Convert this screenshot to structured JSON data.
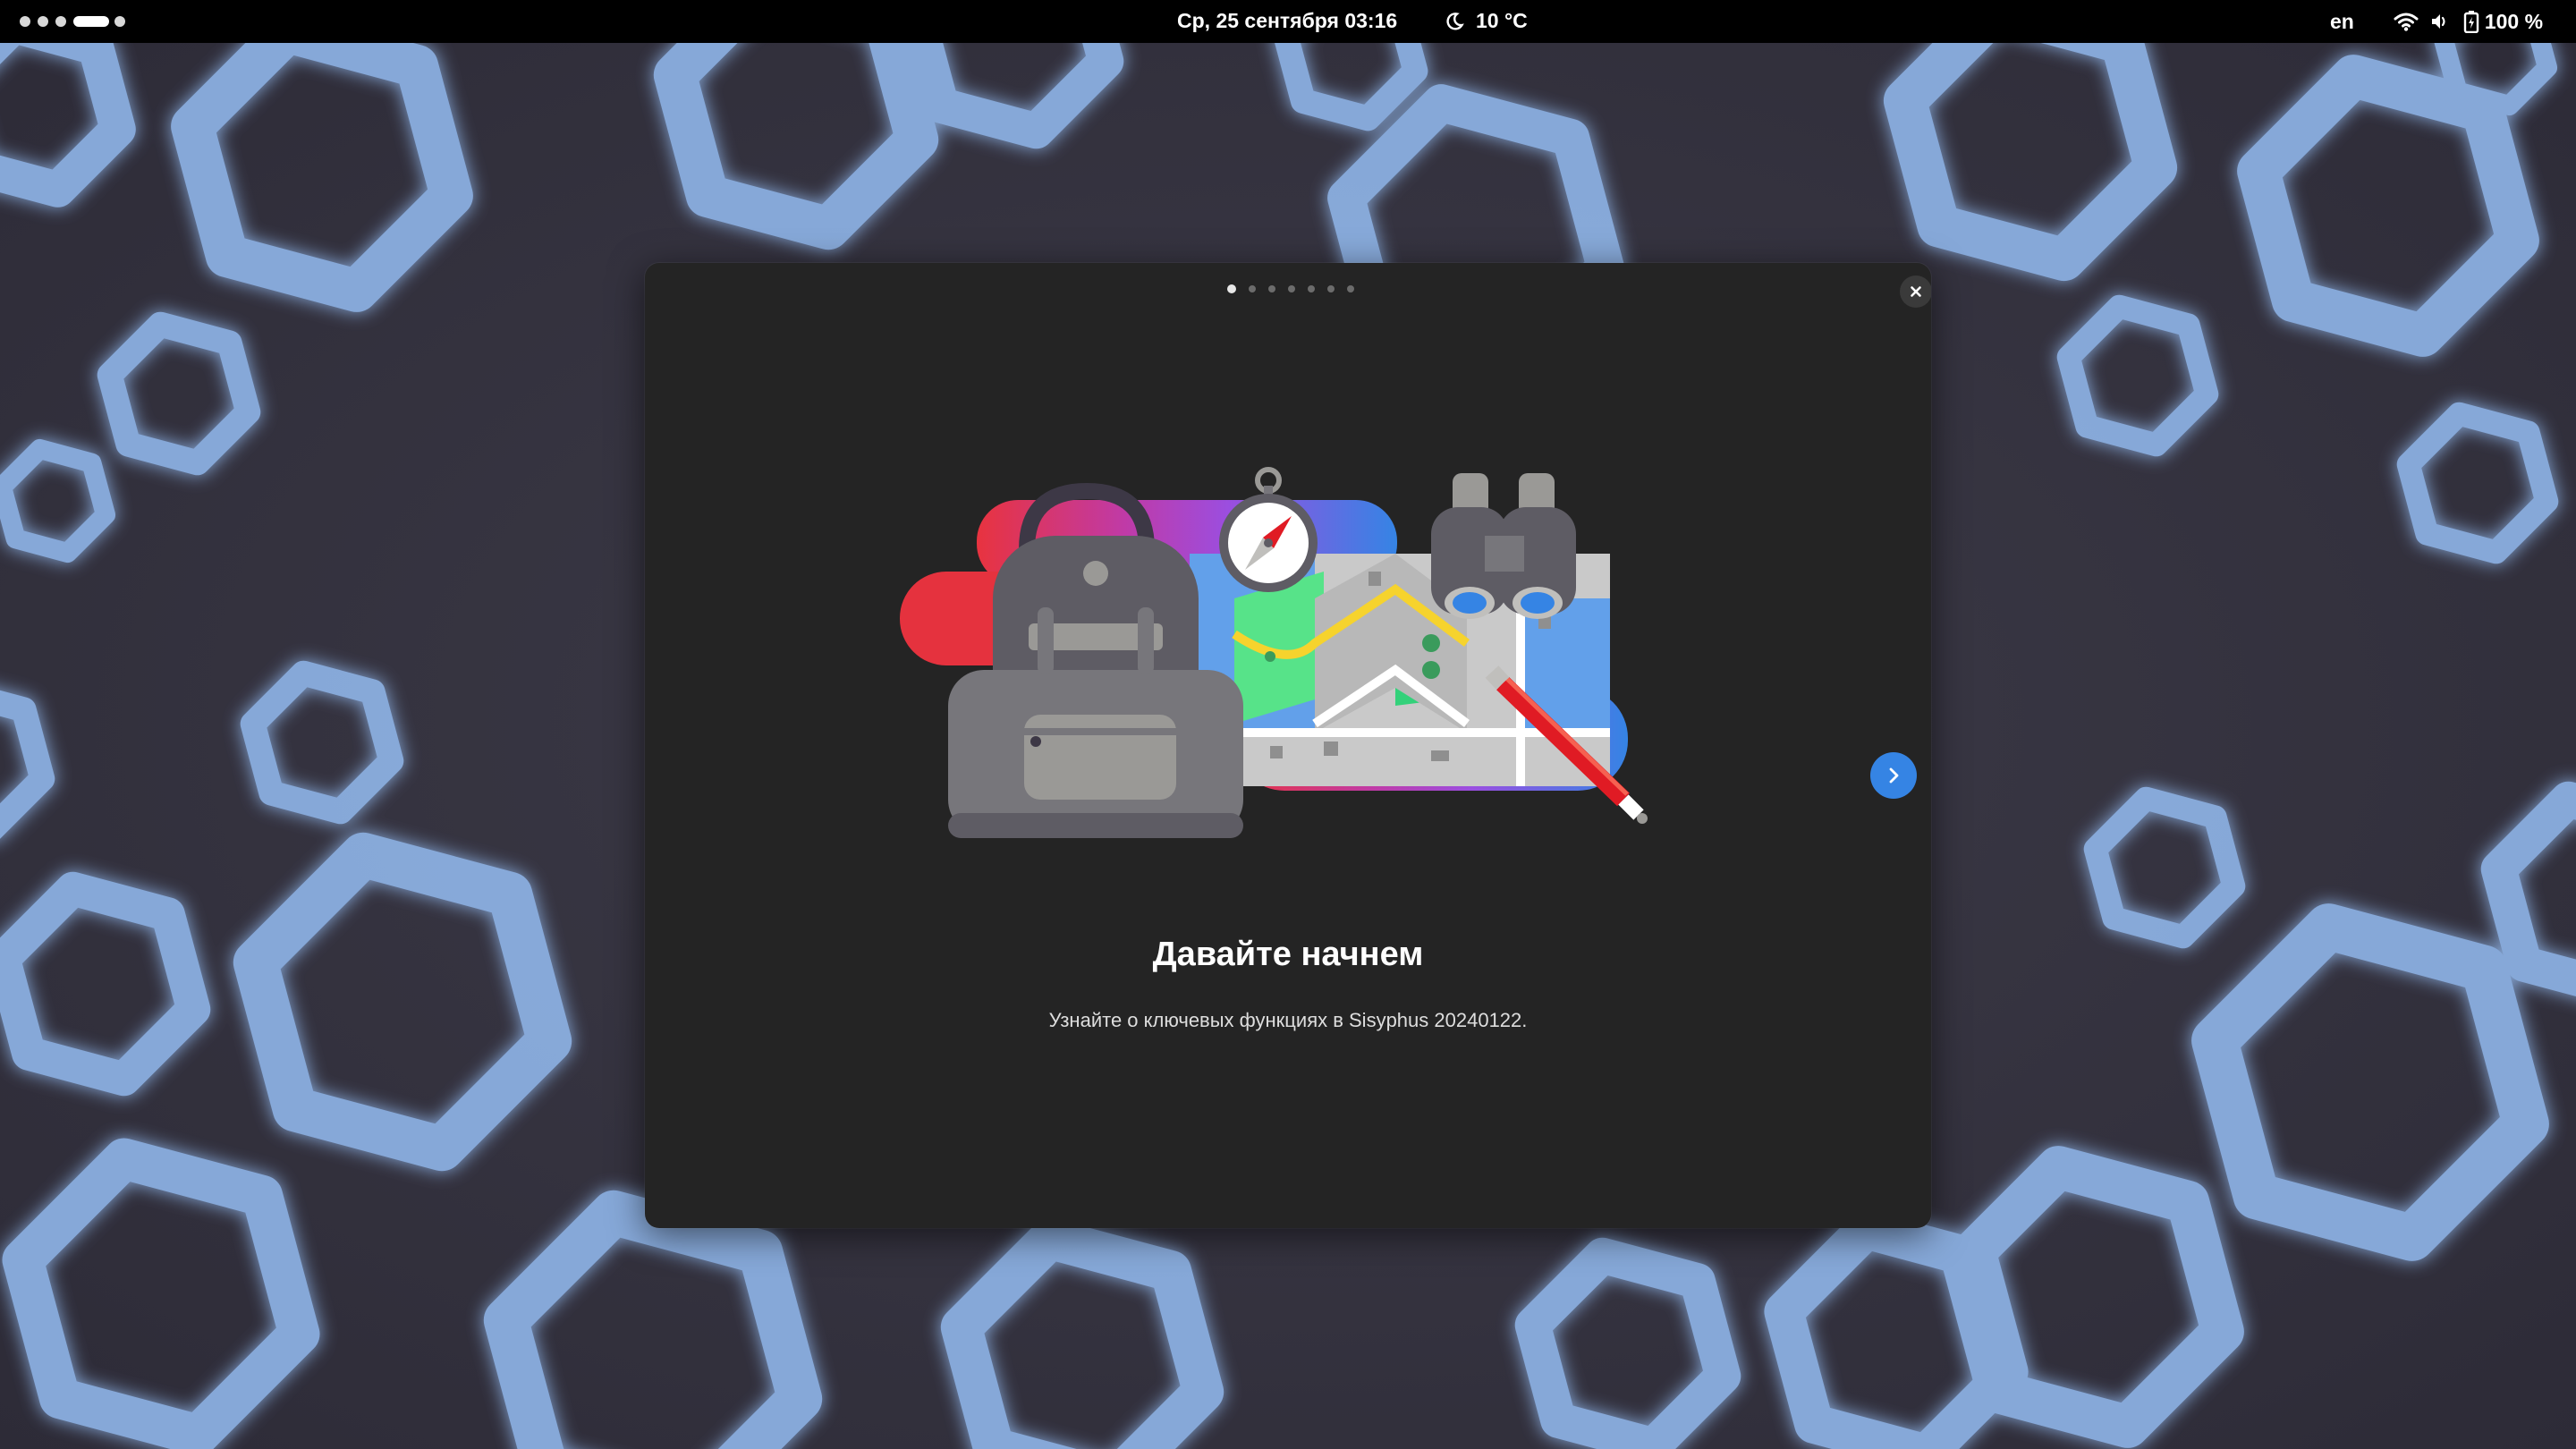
{
  "topbar": {
    "workspaces": [
      "workspace-1",
      "workspace-2",
      "workspace-3",
      "workspace-4-active",
      "workspace-5"
    ],
    "clock": "Ср, 25 сентября  03:16",
    "weather": {
      "icon": "moon-icon",
      "temperature": "10 °C"
    },
    "keyboard_layout": "en",
    "battery_percent": "100 %"
  },
  "dialog": {
    "page_count": 7,
    "current_page": 1,
    "title": "Давайте начнем",
    "subtitle": "Узнайте о ключевых функциях в Sisyphus 20240122.",
    "accent_color": "#3584e4"
  }
}
